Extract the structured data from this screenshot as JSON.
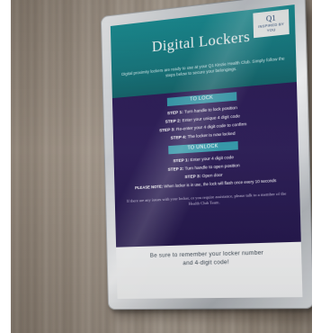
{
  "sign": {
    "brand_logo": "Q1",
    "brand_tagline": "INSPIRED BY YOU",
    "title": "Digital Lockers",
    "intro": "Digital proximity lockers are ready to use at your Q1 Kinzie Health Club. Simply follow the steps below to secure your belongings.",
    "lock": {
      "heading": "TO LOCK",
      "steps": [
        {
          "label": "STEP 1:",
          "text": "Turn handle to lock position"
        },
        {
          "label": "STEP 2:",
          "text": "Enter your unique 4 digit code"
        },
        {
          "label": "STEP 3:",
          "text": "Re-enter your 4 digit code to confirm"
        },
        {
          "label": "STEP 4:",
          "text": "The locker is now locked"
        }
      ]
    },
    "unlock": {
      "heading": "TO UNLOCK",
      "steps": [
        {
          "label": "STEP 1:",
          "text": "Enter your 4 digit code"
        },
        {
          "label": "STEP 2:",
          "text": "Turn handle to open position"
        },
        {
          "label": "STEP 3:",
          "text": "Open door"
        }
      ]
    },
    "note_label": "PLEASE NOTE:",
    "note_text": "When locker is in use, the lock will flash once every 10 seconds",
    "help_text": "If there are any issues with your locker, or you require assistance, please talk to a member of the Health Club Team.",
    "footer_line1": "Be sure to remember your locker number",
    "footer_line2": "and 4-digit code!"
  },
  "colors": {
    "header_teal": "#15777e",
    "body_purple": "#22154b",
    "section_head_blue": "#2f94a6",
    "frame_silver": "#c3c7cc",
    "wall_wood": "#a79b8e"
  }
}
